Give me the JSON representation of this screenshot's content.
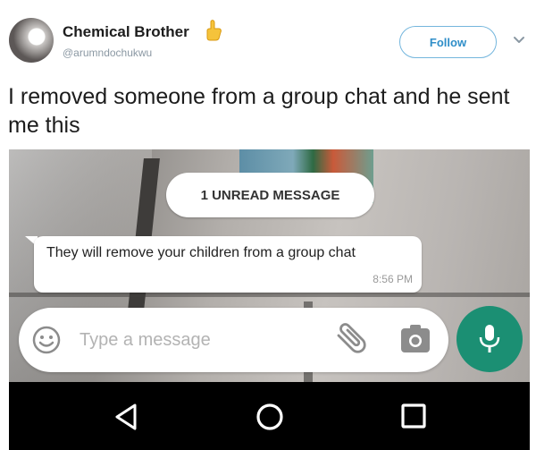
{
  "tweet": {
    "author_name": "Chemical Brother",
    "author_handle": "@arumndochukwu",
    "follow_label": "Follow",
    "text": "I removed someone from a group chat and he sent me this"
  },
  "chat": {
    "unread_banner": "1 UNREAD MESSAGE",
    "message_text": "They will remove your children from a group chat",
    "message_time": "8:56 PM",
    "input_placeholder": "Type a message",
    "input_value": ""
  },
  "icons": {
    "name_emoji": "pointing-hand-icon",
    "menu": "chevron-down-icon",
    "emoji": "smiley-icon",
    "attach": "paperclip-icon",
    "camera": "camera-icon",
    "mic": "microphone-icon",
    "nav": [
      "back-icon",
      "home-icon",
      "recents-icon"
    ]
  },
  "colors": {
    "follow_text": "#2f8ec8",
    "follow_border": "#74b6dd",
    "mic_button": "#1b8f73",
    "handle": "#8b98a3"
  }
}
